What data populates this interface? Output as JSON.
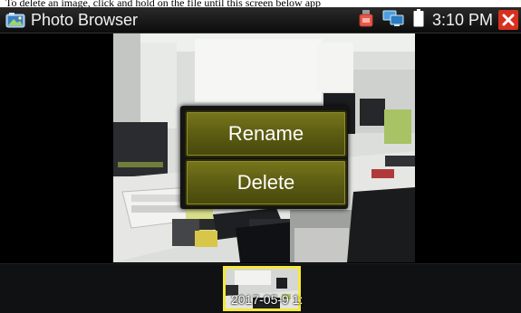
{
  "caption": "To delete an image, click and hold on the file until this screen below app",
  "header": {
    "app_title": "Photo Browser",
    "time": "3:10 PM",
    "icons": [
      "photo-browser-icon",
      "recorder-icon",
      "network-icon",
      "battery-icon",
      "close-icon"
    ],
    "close_color": "#d8301f"
  },
  "context_menu": {
    "rename_label": "Rename",
    "delete_label": "Delete",
    "button_color": "#5a5a12"
  },
  "thumbnails": [
    {
      "date": "2017-05-9 1:",
      "selected": true,
      "highlight_color": "#f5e93a"
    }
  ]
}
